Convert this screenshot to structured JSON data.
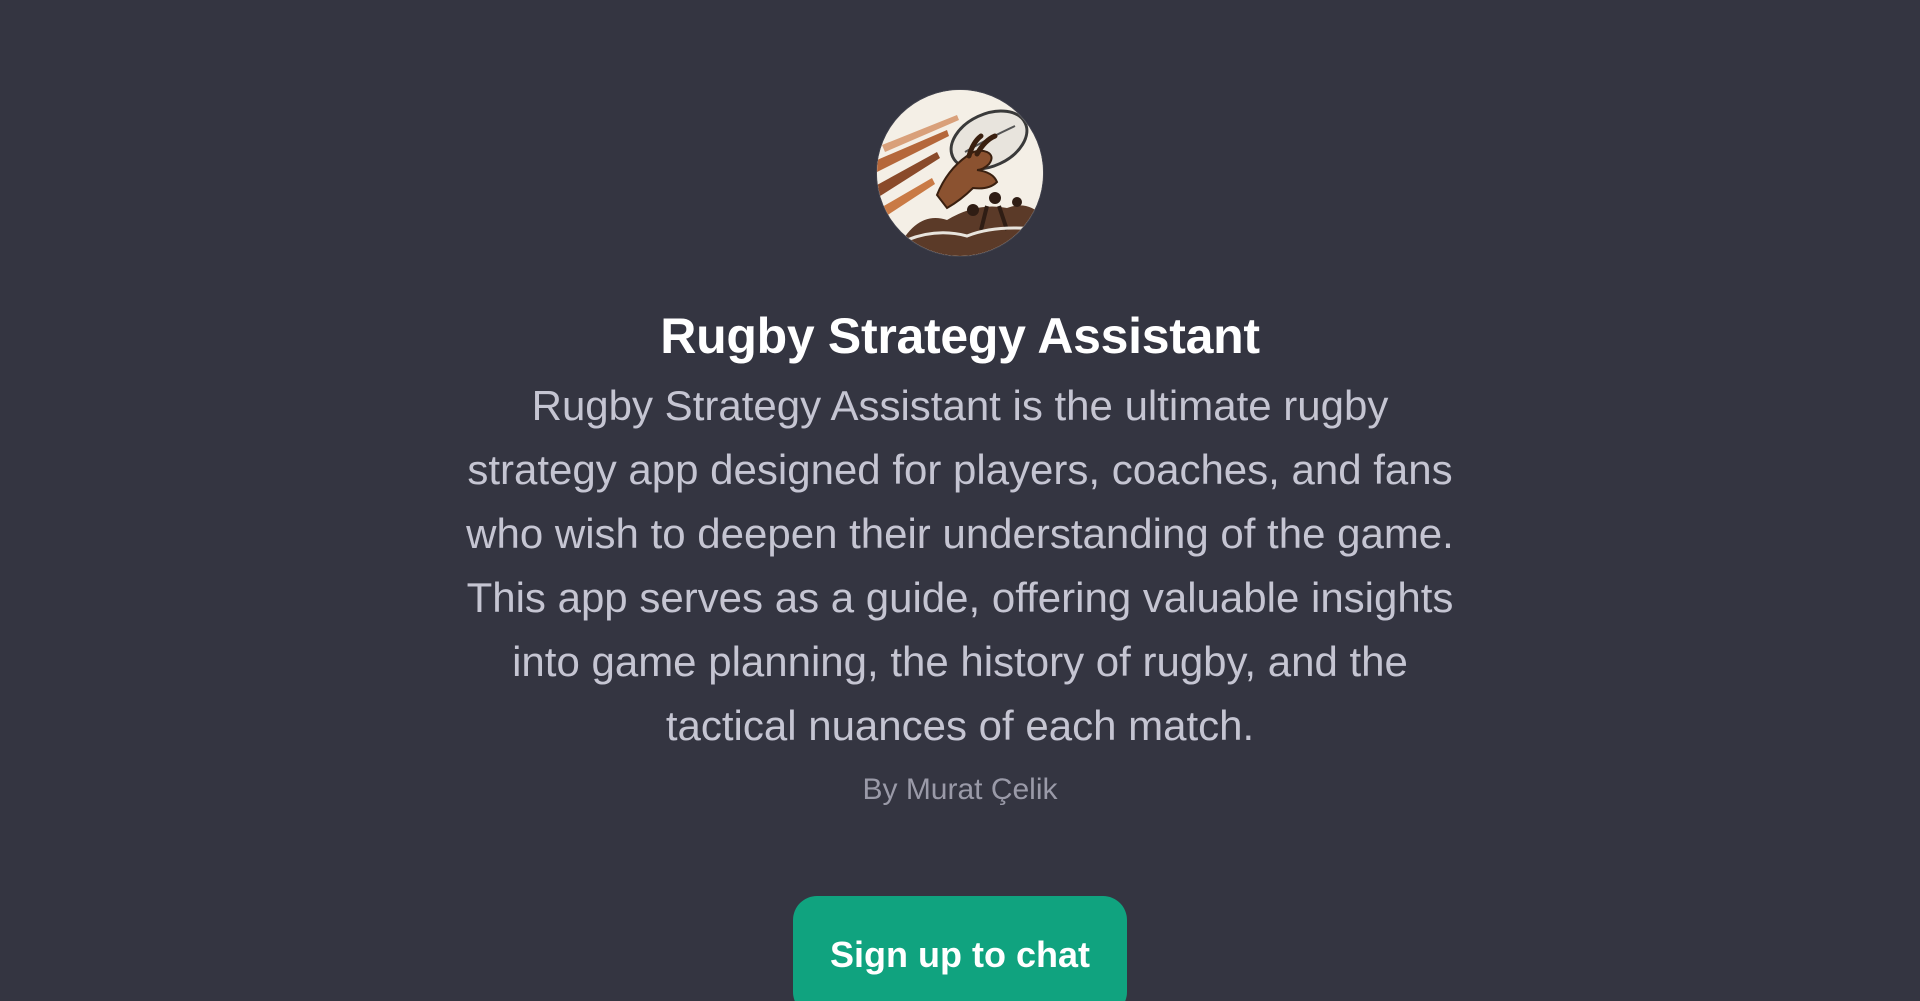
{
  "gpt": {
    "avatar_icon": "rugby-ball-hand-illustration",
    "title": "Rugby Strategy Assistant",
    "description": "Rugby Strategy Assistant is the ultimate rugby strategy app designed for players, coaches, and fans who wish to deepen their understanding of the game. This app serves as a guide, offering valuable insights into game planning, the history of rugby, and the tactical nuances of each match.",
    "author": "By Murat Çelik"
  },
  "cta": {
    "label": "Sign up to chat"
  },
  "colors": {
    "background": "#343541",
    "accent": "#10a37f",
    "title": "#ffffff",
    "body_text": "#c5c5d2",
    "muted_text": "#9a9aa8"
  }
}
